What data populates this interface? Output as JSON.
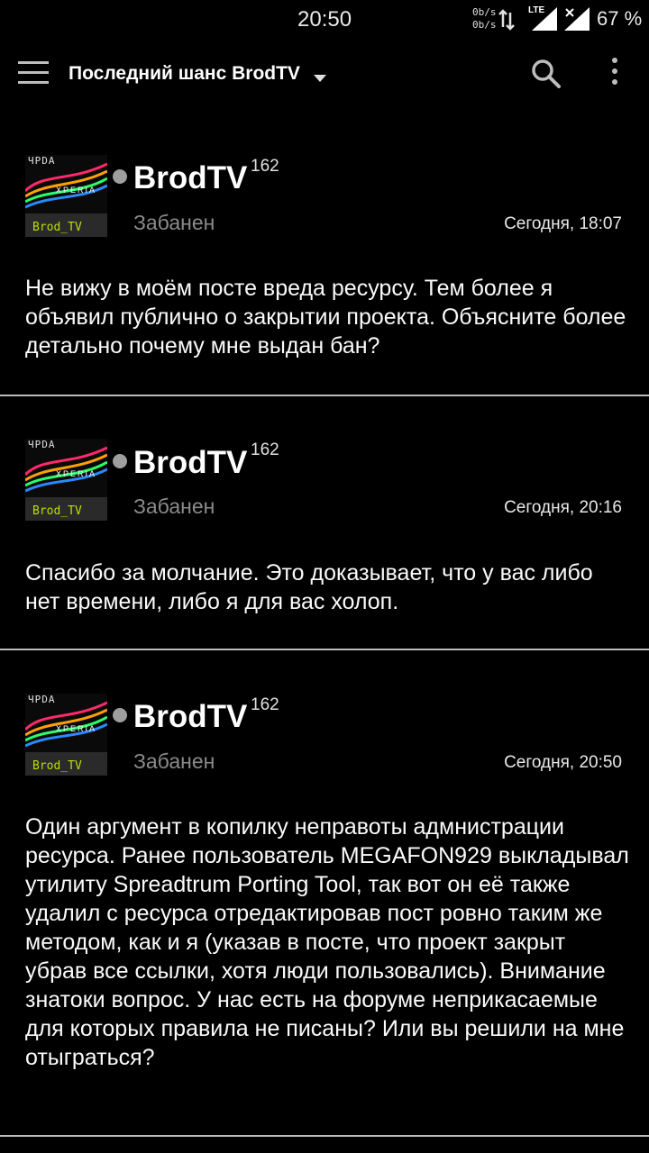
{
  "status_bar": {
    "time": "20:50",
    "speed_up": "0b/s",
    "speed_down": "0b/s",
    "network": "LTE",
    "battery": "67 %"
  },
  "toolbar": {
    "title": "Последний шанс BrodTV",
    "menu_icon": "hamburger-menu-icon",
    "dropdown_icon": "triangle-down-icon",
    "search_icon": "search-icon",
    "more_icon": "more-vertical-icon"
  },
  "avatar": {
    "top_text": "ЧPDA",
    "middle_text": "XPERIA",
    "bottom_text": "Brod_TV"
  },
  "posts": [
    {
      "username": "BrodTV",
      "reputation": "162",
      "status": "Забанен",
      "date": "Сегодня, 18:07",
      "text": "Не вижу в моём посте вреда ресурсу. Тем более я объявил публично о закрытии проекта. Объясните более детально почему мне выдан бан?"
    },
    {
      "username": "BrodTV",
      "reputation": "162",
      "status": "Забанен",
      "date": "Сегодня, 20:16",
      "text": "Спасибо за молчание. Это доказывает, что у вас либо нет времени, либо я для вас холоп."
    },
    {
      "username": "BrodTV",
      "reputation": "162",
      "status": "Забанен",
      "date": "Сегодня, 20:50",
      "text": "Один аргумент в копилку неправоты адмнистрации ресурса. Ранее пользователь MEGAFON929 выкладывал утилиту Spreadtrum Porting Tool, так вот он её также удалил с ресурса отредактировав пост ровно таким же методом, как и я (указав в посте, что проект закрыт убрав все ссылки, хотя люди пользовались). Внимание знатоки вопрос. У нас есть на форуме неприкасаемые для которых правила не писаны? Или вы решили на мне отыграться?"
    }
  ]
}
